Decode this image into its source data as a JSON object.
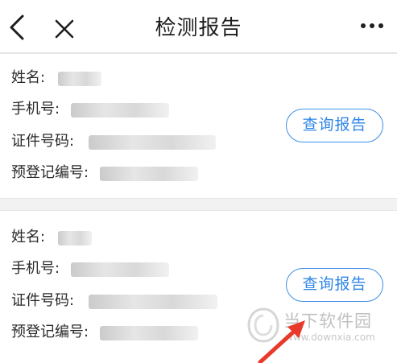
{
  "nav": {
    "title": "检测报告",
    "icons": [
      "back-chevron-icon",
      "close-icon",
      "more-icon"
    ]
  },
  "records": [
    {
      "name_label": "姓名:",
      "phone_label": "手机号:",
      "id_label": "证件号码:",
      "reg_label": "预登记编号:",
      "button_label": "查询报告"
    },
    {
      "name_label": "姓名:",
      "phone_label": "手机号:",
      "id_label": "证件号码:",
      "reg_label": "预登记编号:",
      "button_label": "查询报告"
    }
  ],
  "watermark": {
    "cn": "当下软件园",
    "url": "www.downxia.com"
  },
  "colors": {
    "accent": "#2f86e8",
    "arrow": "#e8392b"
  }
}
